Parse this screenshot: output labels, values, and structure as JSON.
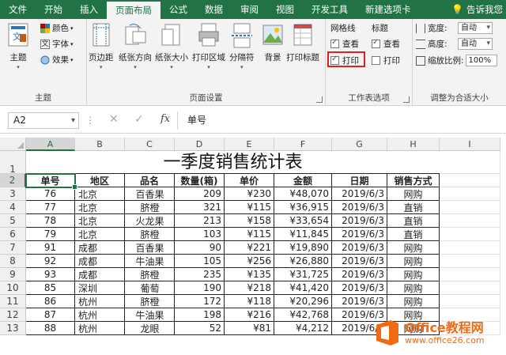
{
  "ribbon_tabs": [
    {
      "label": "文件",
      "active": false
    },
    {
      "label": "开始",
      "active": false
    },
    {
      "label": "插入",
      "active": false
    },
    {
      "label": "页面布局",
      "active": true
    },
    {
      "label": "公式",
      "active": false
    },
    {
      "label": "数据",
      "active": false
    },
    {
      "label": "审阅",
      "active": false
    },
    {
      "label": "视图",
      "active": false
    },
    {
      "label": "开发工具",
      "active": false
    },
    {
      "label": "新建选项卡",
      "active": false
    }
  ],
  "tell_me": "告诉我您",
  "theme_group": {
    "label": "主题",
    "themes_button": "主题",
    "colors": "颜色",
    "fonts": "字体",
    "effects": "效果"
  },
  "page_setup_group": {
    "label": "页面设置",
    "buttons": [
      "页边距",
      "纸张方向",
      "纸张大小",
      "打印区域",
      "分隔符",
      "背景",
      "打印标题"
    ]
  },
  "sheet_options_group": {
    "label": "工作表选项",
    "gridlines_header": "网格线",
    "headings_header": "标题",
    "gridlines_view": {
      "label": "查看",
      "checked": true
    },
    "gridlines_print": {
      "label": "打印",
      "checked": true
    },
    "headings_view": {
      "label": "查看",
      "checked": true
    },
    "headings_print": {
      "label": "打印",
      "checked": false
    }
  },
  "scale_group": {
    "label": "调整为合适大小",
    "width_label": "宽度:",
    "width_value": "自动",
    "height_label": "高度:",
    "height_value": "自动",
    "scale_label": "缩放比例:",
    "scale_value": "100%"
  },
  "formula_bar": {
    "name_box": "A2",
    "cancel": "✕",
    "enter": "✓",
    "fx": "fx",
    "content": "单号"
  },
  "columns": [
    "A",
    "B",
    "C",
    "D",
    "E",
    "F",
    "G",
    "H",
    "I"
  ],
  "rows": [
    "1",
    "2",
    "3",
    "4",
    "5",
    "6",
    "7",
    "8",
    "9",
    "10",
    "11",
    "12",
    "13"
  ],
  "selected_cell": "A2",
  "sheet_title": "一季度销售统计表",
  "table": {
    "headers": [
      "单号",
      "地区",
      "品名",
      "数量(箱)",
      "单价",
      "金额",
      "日期",
      "销售方式"
    ],
    "rows": [
      [
        "76",
        "北京",
        "百香果",
        "209",
        "¥230",
        "¥48,070",
        "2019/6/3",
        "网购"
      ],
      [
        "77",
        "北京",
        "脐橙",
        "321",
        "¥115",
        "¥36,915",
        "2019/6/3",
        "直销"
      ],
      [
        "78",
        "北京",
        "火龙果",
        "213",
        "¥158",
        "¥33,654",
        "2019/6/3",
        "直销"
      ],
      [
        "79",
        "北京",
        "脐橙",
        "103",
        "¥115",
        "¥11,845",
        "2019/6/3",
        "直销"
      ],
      [
        "91",
        "成都",
        "百香果",
        "90",
        "¥221",
        "¥19,890",
        "2019/6/3",
        "网购"
      ],
      [
        "92",
        "成都",
        "牛油果",
        "105",
        "¥256",
        "¥26,880",
        "2019/6/3",
        "网购"
      ],
      [
        "93",
        "成都",
        "脐橙",
        "235",
        "¥135",
        "¥31,725",
        "2019/6/3",
        "网购"
      ],
      [
        "85",
        "深圳",
        "葡萄",
        "190",
        "¥218",
        "¥41,420",
        "2019/6/3",
        "网购"
      ],
      [
        "86",
        "杭州",
        "脐橙",
        "172",
        "¥118",
        "¥20,296",
        "2019/6/3",
        "网购"
      ],
      [
        "87",
        "杭州",
        "牛油果",
        "198",
        "¥216",
        "¥42,768",
        "2019/6/3",
        "网购"
      ],
      [
        "88",
        "杭州",
        "龙眼",
        "52",
        "¥81",
        "¥4,212",
        "2019/6/3",
        "网购"
      ]
    ]
  },
  "watermark": {
    "title": "Office教程网",
    "url": "www.office26.com"
  },
  "colors": {
    "excel_green": "#217346",
    "highlight_red": "#e02020",
    "watermark_orange": "#f06a12"
  }
}
